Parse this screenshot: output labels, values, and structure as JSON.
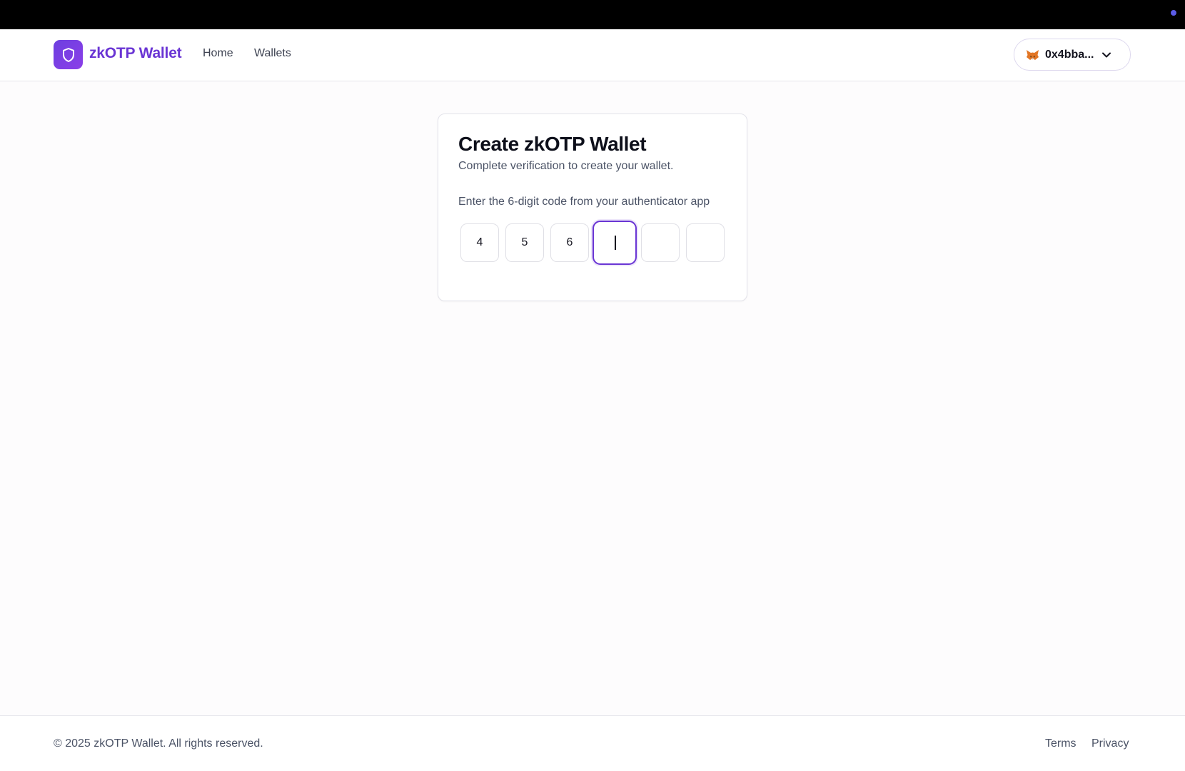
{
  "header": {
    "brand": "zkOTP Wallet",
    "nav": [
      {
        "label": "Home"
      },
      {
        "label": "Wallets"
      }
    ],
    "account": {
      "label": "0x4bba...",
      "icon": "metamask-fox-icon"
    }
  },
  "card": {
    "title": "Create zkOTP Wallet",
    "subtitle": "Complete verification to create your wallet.",
    "code_label": "Enter the 6-digit code from your authenticator app",
    "digits": [
      "4",
      "5",
      "6",
      "",
      "",
      ""
    ],
    "active_index": 3
  },
  "footer": {
    "copyright": "© 2025 zkOTP Wallet. All rights reserved.",
    "links": [
      {
        "label": "Terms"
      },
      {
        "label": "Privacy"
      }
    ]
  },
  "colors": {
    "accent": "#6a35d4",
    "topbar": "#000000"
  }
}
